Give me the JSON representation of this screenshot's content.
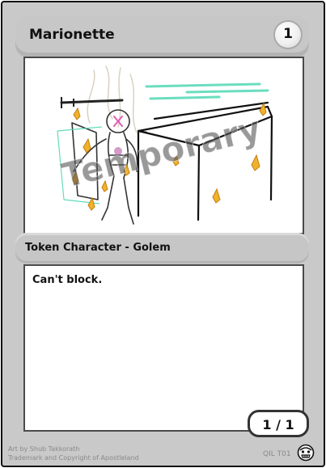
{
  "card": {
    "name": "Marionette",
    "cost": "1",
    "type_line": "Token Character - Golem",
    "rules_text": "Can't block.",
    "collector_number": "1 / 1",
    "art_watermark": "Temporary",
    "artist_credit": "Art by Shub Takkorath",
    "copyright": "Trademark and Copyright of Apostleland",
    "set_code": "QIL T01",
    "set_logo_icon": "set-symbol-face-icon"
  },
  "colors": {
    "frame": "#c9c9c9",
    "border": "#111111",
    "panel": "#ffffff",
    "watermark": "#555555",
    "sketch_gold": "#e6a21a",
    "sketch_teal": "#52d8b4"
  }
}
